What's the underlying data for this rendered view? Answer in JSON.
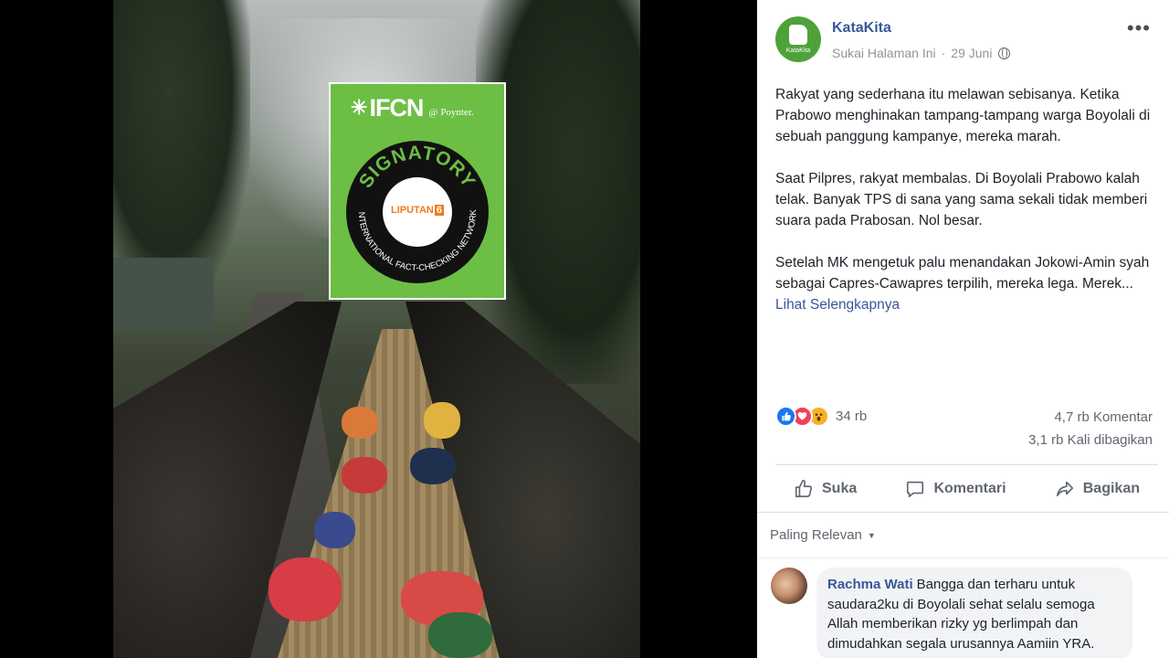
{
  "badge": {
    "org": "IFCN",
    "by": "@ Poynter.",
    "ring_top": "SIGNATORY",
    "ring_bottom": "INTERNATIONAL FACT-CHECKING NETWORK",
    "member_name": "LIPUTAN",
    "member_number": "6"
  },
  "post": {
    "page_name": "KataKita",
    "logo_caption": "KataKita",
    "follow_label": "Sukai Halaman Ini",
    "separator": "·",
    "date": "29 Juni",
    "more_icon": "more-dots-icon",
    "paragraphs": [
      "Rakyat yang sederhana itu melawan sebisanya. Ketika Prabowo menghinakan tampang-tampang warga Boyolali di sebuah panggung kampanye, mereka marah.",
      "Saat Pilpres, rakyat membalas. Di Boyolali Prabowo kalah telak. Banyak TPS di sana yang sama sekali tidak memberi suara pada Prabosan. Nol besar."
    ],
    "last_paragraph": "Setelah MK mengetuk palu menandakan Jokowi-Amin syah sebagai Capres-Cawapres terpilih, mereka lega. Merek...",
    "see_more": "Lihat Selengkapnya",
    "reactions_count": "34 rb",
    "comments_count": "4,7 rb Komentar",
    "shares_count": "3,1 rb Kali dibagikan"
  },
  "actions": {
    "like": "Suka",
    "comment": "Komentari",
    "share": "Bagikan"
  },
  "comments": {
    "sort_label": "Paling Relevan",
    "items": [
      {
        "author": "Rachma Wati",
        "text": "Bangga dan terharu untuk saudara2ku di Boyolali sehat selalu semoga Allah memberikan rizky yg berlimpah dan dimudahkan segala urusannya Aamiin YRA."
      }
    ]
  },
  "colors": {
    "fb_blue": "#385898",
    "badge_green": "#6cbe45",
    "liputan_orange": "#f07a1b"
  }
}
